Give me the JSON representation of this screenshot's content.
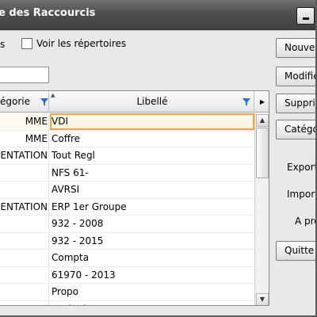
{
  "window": {
    "title": "e des Raccourcis"
  },
  "filters": {
    "prefix_fragment": "s",
    "checkbox_label": "Voir les répertoires",
    "checkbox_checked": false,
    "search_value": ""
  },
  "table": {
    "columns": {
      "category": "égorie",
      "libelle": "Libellé"
    },
    "rows": [
      {
        "category": "MME",
        "libelle": "VDI",
        "selected": true
      },
      {
        "category": "MME",
        "libelle": "Coffre"
      },
      {
        "category": "ENTATION",
        "libelle": "Tout Regl"
      },
      {
        "category": "",
        "libelle": "NFS 61-"
      },
      {
        "category": "",
        "libelle": "AVRSI"
      },
      {
        "category": "ENTATION",
        "libelle": "ERP 1er Groupe"
      },
      {
        "category": "",
        "libelle": "932 - 2008"
      },
      {
        "category": "",
        "libelle": "932 - 2015"
      },
      {
        "category": "",
        "libelle": "Compta"
      },
      {
        "category": "",
        "libelle": "61970 - 2013"
      },
      {
        "category": "",
        "libelle": "Propo"
      },
      {
        "category": "",
        "libelle": "Ecole du centre"
      }
    ]
  },
  "buttons": {
    "new": "Nouvea",
    "modify": "Modifie",
    "delete": "Supprime",
    "categories": "Catégorie",
    "quit": "Quitte"
  },
  "labels": {
    "export": "Export",
    "import": "Import",
    "about": "A pro"
  },
  "colors": {
    "titlebar": "#4f4f4f",
    "selection_outline": "#f0a63a",
    "filter_icon": "#2b6fd6"
  },
  "icons": {
    "filter": "funnel-icon",
    "minimize": "minimize-icon",
    "more_columns": "arrow-right-icon"
  }
}
